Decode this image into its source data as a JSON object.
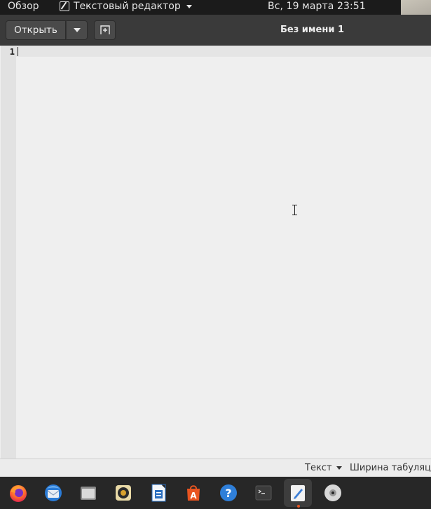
{
  "topbar": {
    "activities": "Обзор",
    "app_name": "Текстовый редактор",
    "clock": "Вс, 19 марта  23:51"
  },
  "headerbar": {
    "open_label": "Открыть",
    "title": "Без имени 1"
  },
  "editor": {
    "line_numbers": [
      "1"
    ],
    "content": ""
  },
  "statusbar": {
    "language": "Текст",
    "tab_width": "Ширина табуляции"
  },
  "dock": {
    "items": [
      {
        "name": "firefox-icon",
        "active": false
      },
      {
        "name": "thunderbird-icon",
        "active": false
      },
      {
        "name": "files-icon",
        "active": false
      },
      {
        "name": "rhythmbox-icon",
        "active": false
      },
      {
        "name": "libreoffice-writer-icon",
        "active": false
      },
      {
        "name": "software-center-icon",
        "active": false
      },
      {
        "name": "help-icon",
        "active": false
      },
      {
        "name": "terminal-icon",
        "active": false
      },
      {
        "name": "text-editor-icon",
        "active": true
      },
      {
        "name": "optical-disc-icon",
        "active": false
      }
    ]
  },
  "colors": {
    "topbar_bg": "#1b1b1b",
    "header_bg": "#3a3a3a",
    "editor_bg": "#efefef",
    "dock_bg": "#272727",
    "accent": "#e95420"
  }
}
